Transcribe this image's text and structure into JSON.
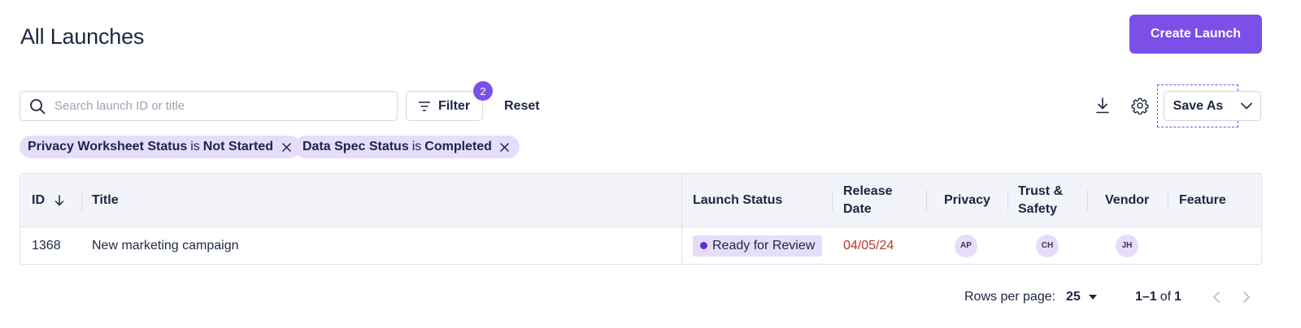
{
  "page": {
    "title": "All Launches"
  },
  "header": {
    "create_label": "Create Launch"
  },
  "toolbar": {
    "search_placeholder": "Search launch ID or title",
    "filter_label": "Filter",
    "filter_count": "2",
    "reset_label": "Reset",
    "save_as_label": "Save As",
    "icons": [
      "download-icon",
      "gear-icon",
      "chevron-down-icon"
    ]
  },
  "filters": [
    {
      "field": "Privacy Worksheet Status",
      "op": "is",
      "value": "Not Started"
    },
    {
      "field": "Data Spec Status",
      "op": "is",
      "value": "Completed"
    }
  ],
  "table": {
    "columns": {
      "id": "ID",
      "title": "Title",
      "launch_status": "Launch Status",
      "release_date": "Release Date",
      "privacy": "Privacy",
      "trust_safety": "Trust & Safety",
      "vendor": "Vendor",
      "feature": "Feature"
    },
    "sort": {
      "column": "ID",
      "direction": "descending"
    },
    "rows": [
      {
        "id": "1368",
        "title": "New marketing campaign",
        "launch_status": "Ready for Review",
        "release_date": "04/05/24",
        "privacy": "AP",
        "trust_safety": "CH",
        "vendor": "JH",
        "feature": ""
      }
    ]
  },
  "pagination": {
    "rows_per_page_label": "Rows per page:",
    "rows_per_page": "25",
    "range": "1–1",
    "of_label": "of",
    "total": "1"
  },
  "colors": {
    "accent": "#7b4fe8",
    "chip_bg": "#e6ddfb",
    "overdue": "#b23a2a",
    "header_bg": "#f3f4f9"
  }
}
